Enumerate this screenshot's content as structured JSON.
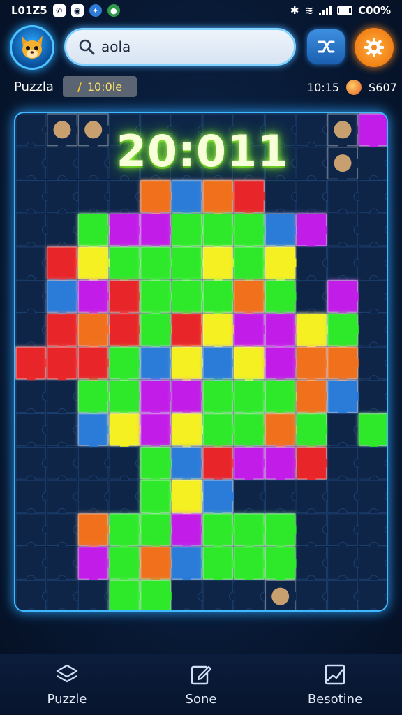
{
  "status_bar": {
    "time": "L01Z5",
    "battery": "C00%"
  },
  "header": {
    "search": {
      "value": "aola",
      "placeholder": ""
    },
    "icons": [
      "avatar-fox",
      "search-icon",
      "share-icon",
      "gear-icon"
    ]
  },
  "info": {
    "mode": "Puzzla",
    "timer": "10:0le",
    "count": "10:15",
    "coins": "S607"
  },
  "board": {
    "timer": "20:011",
    "grid": {
      "cols": 12,
      "rows": 15
    },
    "colors": {
      "green": "#2ee82a",
      "lime": "#8aff2a",
      "yellow": "#f4f020",
      "magenta": "#c21ee8",
      "red": "#e8282a",
      "orange": "#f0701e",
      "blue": "#2a7bd8",
      "empty": "#0e2548"
    },
    "layout": [
      [
        "E",
        "P",
        "P",
        "E",
        "E",
        "E",
        "E",
        "E",
        "E",
        "E",
        "P",
        "M"
      ],
      [
        "E",
        "E",
        "E",
        "E",
        "E",
        "E",
        "E",
        "E",
        "E",
        "E",
        "P",
        "E"
      ],
      [
        "E",
        "E",
        "E",
        "E",
        "O",
        "B",
        "O",
        "R",
        "E",
        "E",
        "E",
        "E"
      ],
      [
        "E",
        "E",
        "G",
        "M",
        "M",
        "G",
        "G",
        "G",
        "B",
        "M",
        "E",
        "E"
      ],
      [
        "E",
        "R",
        "Y",
        "G",
        "G",
        "G",
        "Y",
        "G",
        "Y",
        "E",
        "E",
        "E"
      ],
      [
        "E",
        "B",
        "M",
        "R",
        "G",
        "G",
        "G",
        "O",
        "G",
        "E",
        "M",
        "E"
      ],
      [
        "E",
        "R",
        "O",
        "R",
        "G",
        "R",
        "Y",
        "M",
        "M",
        "Y",
        "G",
        "E"
      ],
      [
        "R",
        "R",
        "R",
        "G",
        "B",
        "Y",
        "B",
        "Y",
        "M",
        "O",
        "O",
        "E"
      ],
      [
        "E",
        "E",
        "G",
        "G",
        "M",
        "M",
        "G",
        "G",
        "G",
        "O",
        "B",
        "E"
      ],
      [
        "E",
        "E",
        "B",
        "Y",
        "M",
        "Y",
        "G",
        "G",
        "O",
        "G",
        "E",
        "G"
      ],
      [
        "E",
        "E",
        "E",
        "E",
        "G",
        "B",
        "R",
        "M",
        "M",
        "R",
        "E",
        "E"
      ],
      [
        "E",
        "E",
        "E",
        "E",
        "G",
        "Y",
        "B",
        "E",
        "E",
        "E",
        "E",
        "E"
      ],
      [
        "E",
        "E",
        "O",
        "G",
        "G",
        "M",
        "G",
        "G",
        "G",
        "E",
        "E",
        "E"
      ],
      [
        "E",
        "E",
        "M",
        "G",
        "O",
        "B",
        "G",
        "G",
        "G",
        "E",
        "E",
        "E"
      ],
      [
        "E",
        "E",
        "E",
        "G",
        "G",
        "E",
        "E",
        "E",
        "P",
        "E",
        "E",
        "E"
      ]
    ]
  },
  "bottom_nav": [
    {
      "label": "Puzzle",
      "icon": "layers-icon"
    },
    {
      "label": "Sone",
      "icon": "edit-icon"
    },
    {
      "label": "Besotine",
      "icon": "image-icon"
    }
  ]
}
